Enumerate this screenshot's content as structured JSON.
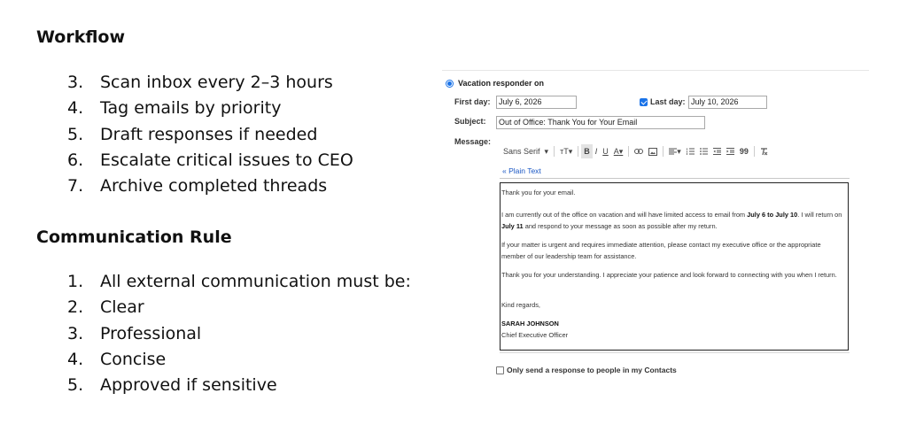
{
  "workflow": {
    "title": "Workflow",
    "items": [
      {
        "num": "3.",
        "text": "Scan inbox every 2–3 hours"
      },
      {
        "num": "4.",
        "text": "Tag emails by priority"
      },
      {
        "num": "5.",
        "text": "Draft responses if needed"
      },
      {
        "num": "6.",
        "text": "Escalate critical issues to CEO"
      },
      {
        "num": "7.",
        "text": "Archive completed threads"
      }
    ]
  },
  "communication": {
    "title": "Communication Rule",
    "items": [
      {
        "num": "1.",
        "text": "All external communication must be:"
      },
      {
        "num": "2.",
        "text": "Clear"
      },
      {
        "num": "3.",
        "text": "Professional"
      },
      {
        "num": "4.",
        "text": "Concise"
      },
      {
        "num": "5.",
        "text": "Approved if sensitive"
      }
    ]
  },
  "vacation": {
    "radio_label": "Vacation responder on",
    "first_day_label": "First day:",
    "first_day_value": "July 6, 2026",
    "last_day_label": "Last day:",
    "last_day_value": "July 10, 2026",
    "subject_label": "Subject:",
    "subject_value": "Out of Office: Thank You for Your Email",
    "message_label": "Message:",
    "toolbar": {
      "font": "Sans Serif",
      "size": "тT",
      "bold": "B",
      "italic": "I",
      "underline": "U",
      "text_color": "A",
      "quote": "99"
    },
    "plain_text_link": "« Plain Text",
    "message": {
      "p1": "Thank you for your email.",
      "p2_a": "I am currently out of the office on vacation and will have limited access to email from ",
      "p2_b": "July 6 to July 10",
      "p2_c": ". I will return on ",
      "p2_d": "July 11",
      "p2_e": " and respond to your message as soon as possible after my return.",
      "p3": "If your matter is urgent and requires immediate attention, please contact my executive office or the appropriate member of our leadership team for assistance.",
      "p4": "Thank you for your understanding. I appreciate your patience and look forward to connecting with you when I return.",
      "p5": "Kind regards,",
      "sig_name": "SARAH JOHNSON",
      "sig_title": "Chief Executive Officer"
    },
    "contacts_only_label": "Only send a response to people in my Contacts"
  }
}
